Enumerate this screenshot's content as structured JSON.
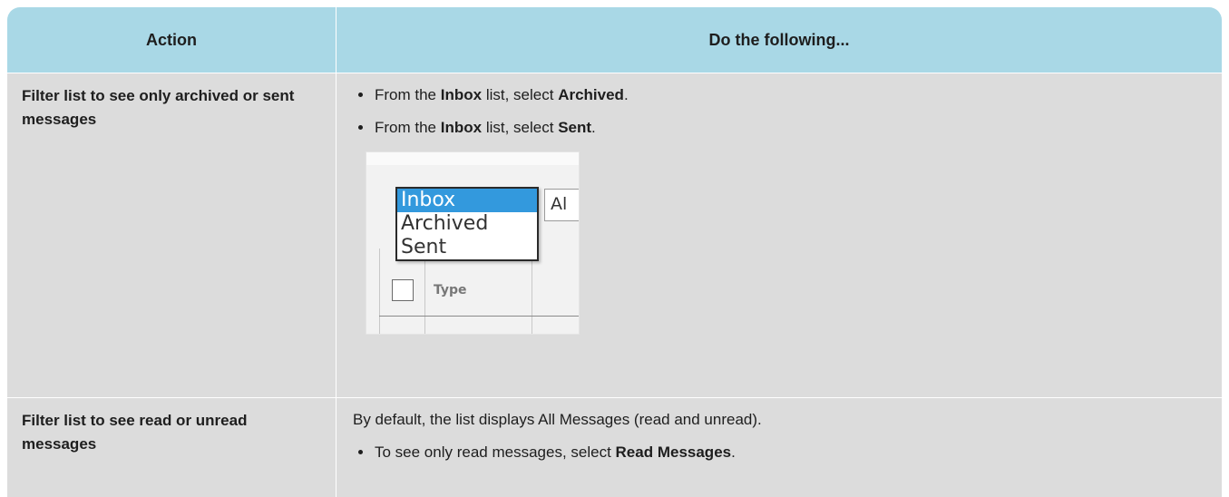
{
  "table": {
    "headers": {
      "action": "Action",
      "do": "Do the following..."
    },
    "rows": [
      {
        "action": "Filter list to see only archived or sent messages",
        "bullets": [
          {
            "pre": "From the ",
            "b1": "Inbox",
            "mid": " list, select ",
            "b2": "Archived",
            "post": "."
          },
          {
            "pre": "From the ",
            "b1": "Inbox",
            "mid": " list, select ",
            "b2": "Sent",
            "post": "."
          }
        ],
        "screenshot": {
          "dropdown_options": [
            "Inbox",
            "Archived",
            "Sent"
          ],
          "selected_option": "Inbox",
          "adjacent_field_text": "Al",
          "column_header_text": "Type"
        }
      },
      {
        "action": "Filter list to see read or unread messages",
        "intro": "By default, the list displays All Messages (read and unread).",
        "bullets": [
          {
            "pre": "To see only read messages, select ",
            "b1": "Read Messages",
            "post": "."
          }
        ]
      }
    ]
  },
  "colors": {
    "header_bg": "#a9d8e6",
    "row_bg": "#dcdcdc",
    "dropdown_selected": "#3399dd"
  }
}
